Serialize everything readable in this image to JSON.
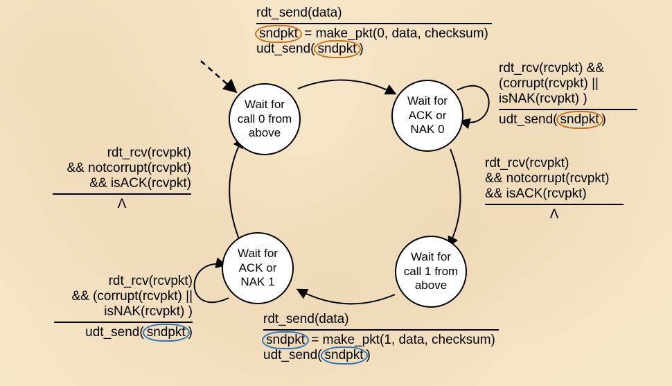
{
  "states": {
    "wait0": "Wait for call 0 from above",
    "waitAckNak0": "Wait for ACK  or NAK 0",
    "wait1": "Wait for call 1 from above",
    "waitAckNak1": "Wait for ACK  or NAK 1"
  },
  "top": {
    "event": "rdt_send(data)",
    "action1_pre": "sndpkt",
    "action1_post": " = make_pkt(0, data, checksum)",
    "action2_pre": "udt_send(",
    "action2_oval": "sndpkt",
    "action2_post": ")"
  },
  "rightSelf": {
    "event1": "rdt_rcv(rcvpkt) &&",
    "event2": "(corrupt(rcvpkt) ||",
    "event3": "isNAK(rcvpkt) )",
    "action_pre": "udt_send(",
    "action_oval": "sndpkt",
    "action_post": ")"
  },
  "rightDown": {
    "event1": "rdt_rcv(rcvpkt)",
    "event2": "&& notcorrupt(rcvpkt)",
    "event3": "&& isACK(rcvpkt)",
    "action": "Λ"
  },
  "bottom": {
    "event": "rdt_send(data)",
    "action1_pre": "sndpkt",
    "action1_post": " = make_pkt(1, data, checksum)",
    "action2_pre": "udt_send(",
    "action2_oval": "sndpkt",
    "action2_post": ")"
  },
  "leftSelf": {
    "event1": "rdt_rcv(rcvpkt)",
    "event2": "&& (corrupt(rcvpkt) ||",
    "event3": "isNAK(rcvpkt) )",
    "action_pre": "udt_send(",
    "action_oval": "sndpkt",
    "action_post": ")"
  },
  "leftUp": {
    "event1": "rdt_rcv(rcvpkt)",
    "event2": "&& notcorrupt(rcvpkt)",
    "event3": "&& isACK(rcvpkt)",
    "action": "Λ"
  }
}
